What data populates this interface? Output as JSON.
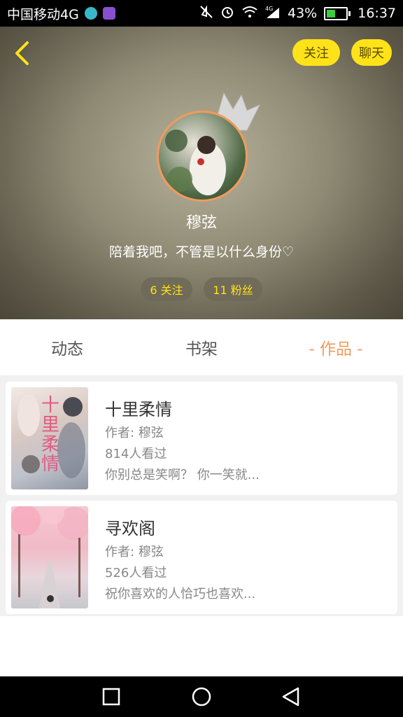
{
  "status_bar": {
    "carrier": "中国移动4G",
    "battery_percent": "43%",
    "time": "16:37",
    "network_label": "4G"
  },
  "header": {
    "follow_label": "关注",
    "chat_label": "聊天",
    "username": "穆弦",
    "bio": "陪着我吧，不管是以什么身份♡",
    "following_stat": "6 关注",
    "fans_stat": "11 粉丝"
  },
  "tabs": [
    {
      "label": "动态"
    },
    {
      "label": "书架"
    },
    {
      "label": "- 作品 -"
    }
  ],
  "books": [
    {
      "title": "十里柔情",
      "author": "作者: 穆弦",
      "views": "814人看过",
      "desc": "你别总是笑啊？ 你一笑就...",
      "cover_text": "十里柔情"
    },
    {
      "title": "寻欢阁",
      "author": "作者: 穆弦",
      "views": "526人看过",
      "desc": "祝你喜欢的人恰巧也喜欢..."
    }
  ],
  "colors": {
    "accent": "#f39a5b",
    "button_yellow": "#ffe318"
  }
}
